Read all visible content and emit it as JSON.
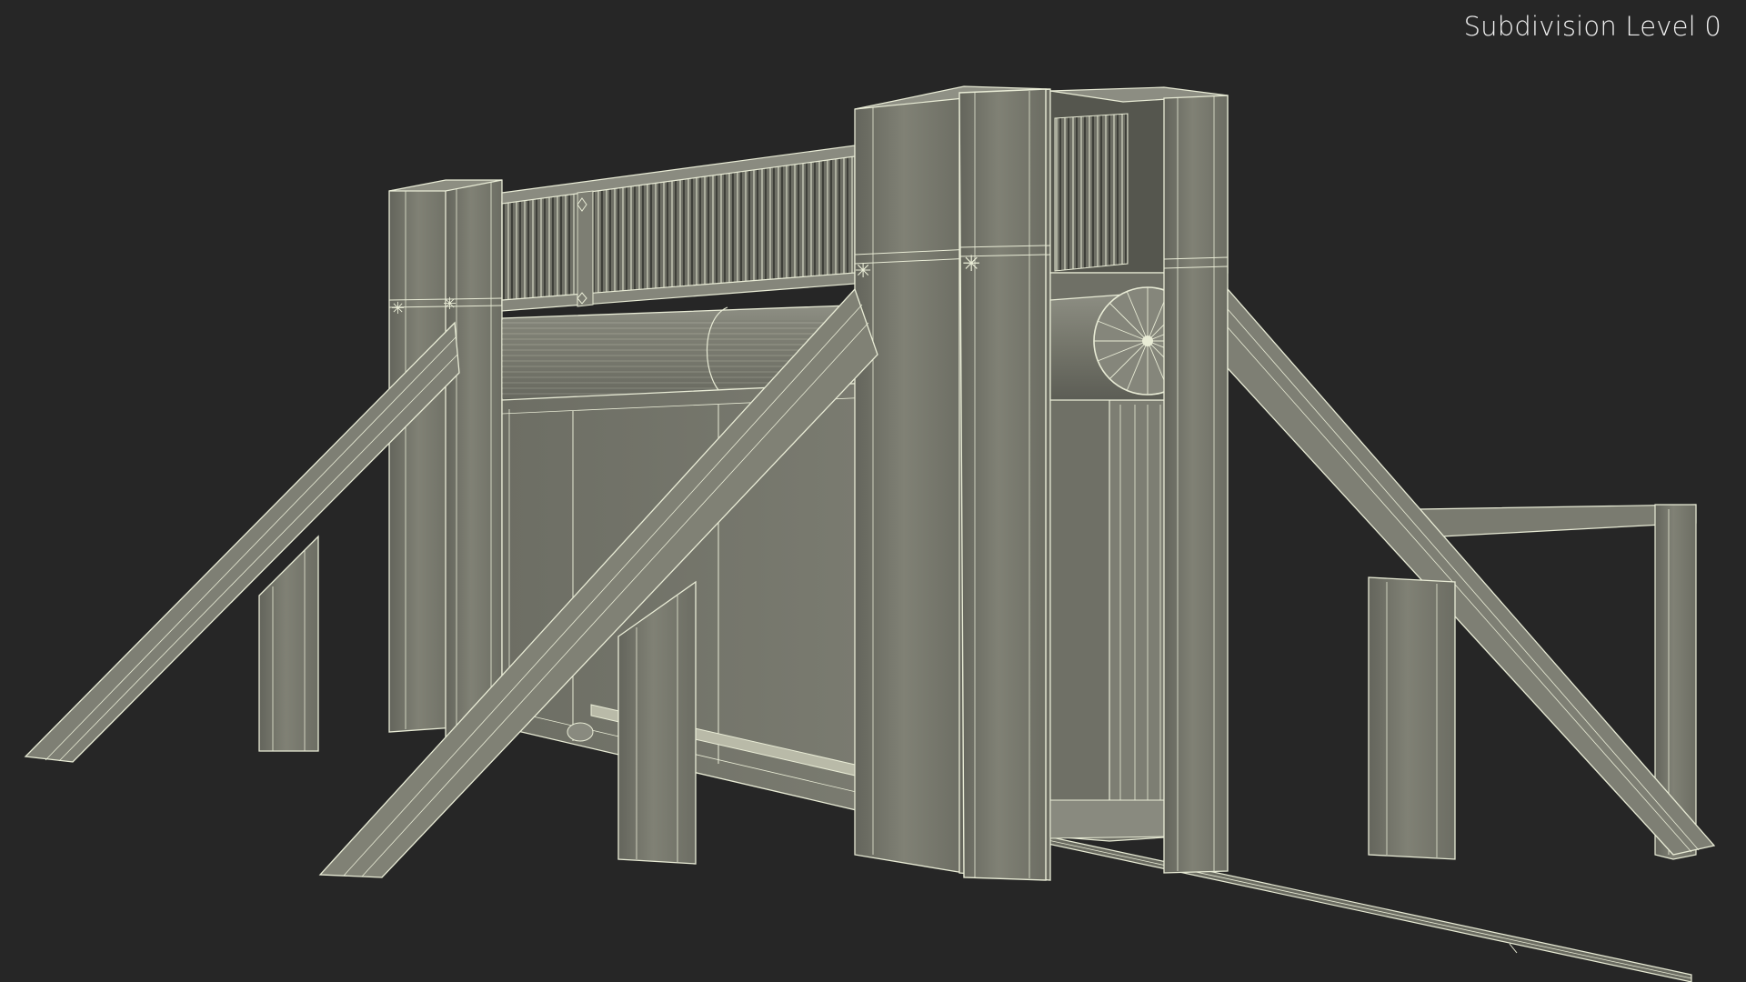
{
  "viewport": {
    "label": "Subdivision Level 0",
    "background": "#262626",
    "model": "sliding-gate-wireframe"
  },
  "colors": {
    "surface": "#7a7b70",
    "surface_dark": "#5f6058",
    "surface_light": "#8b8c81",
    "wire": "#e9ecd6"
  }
}
